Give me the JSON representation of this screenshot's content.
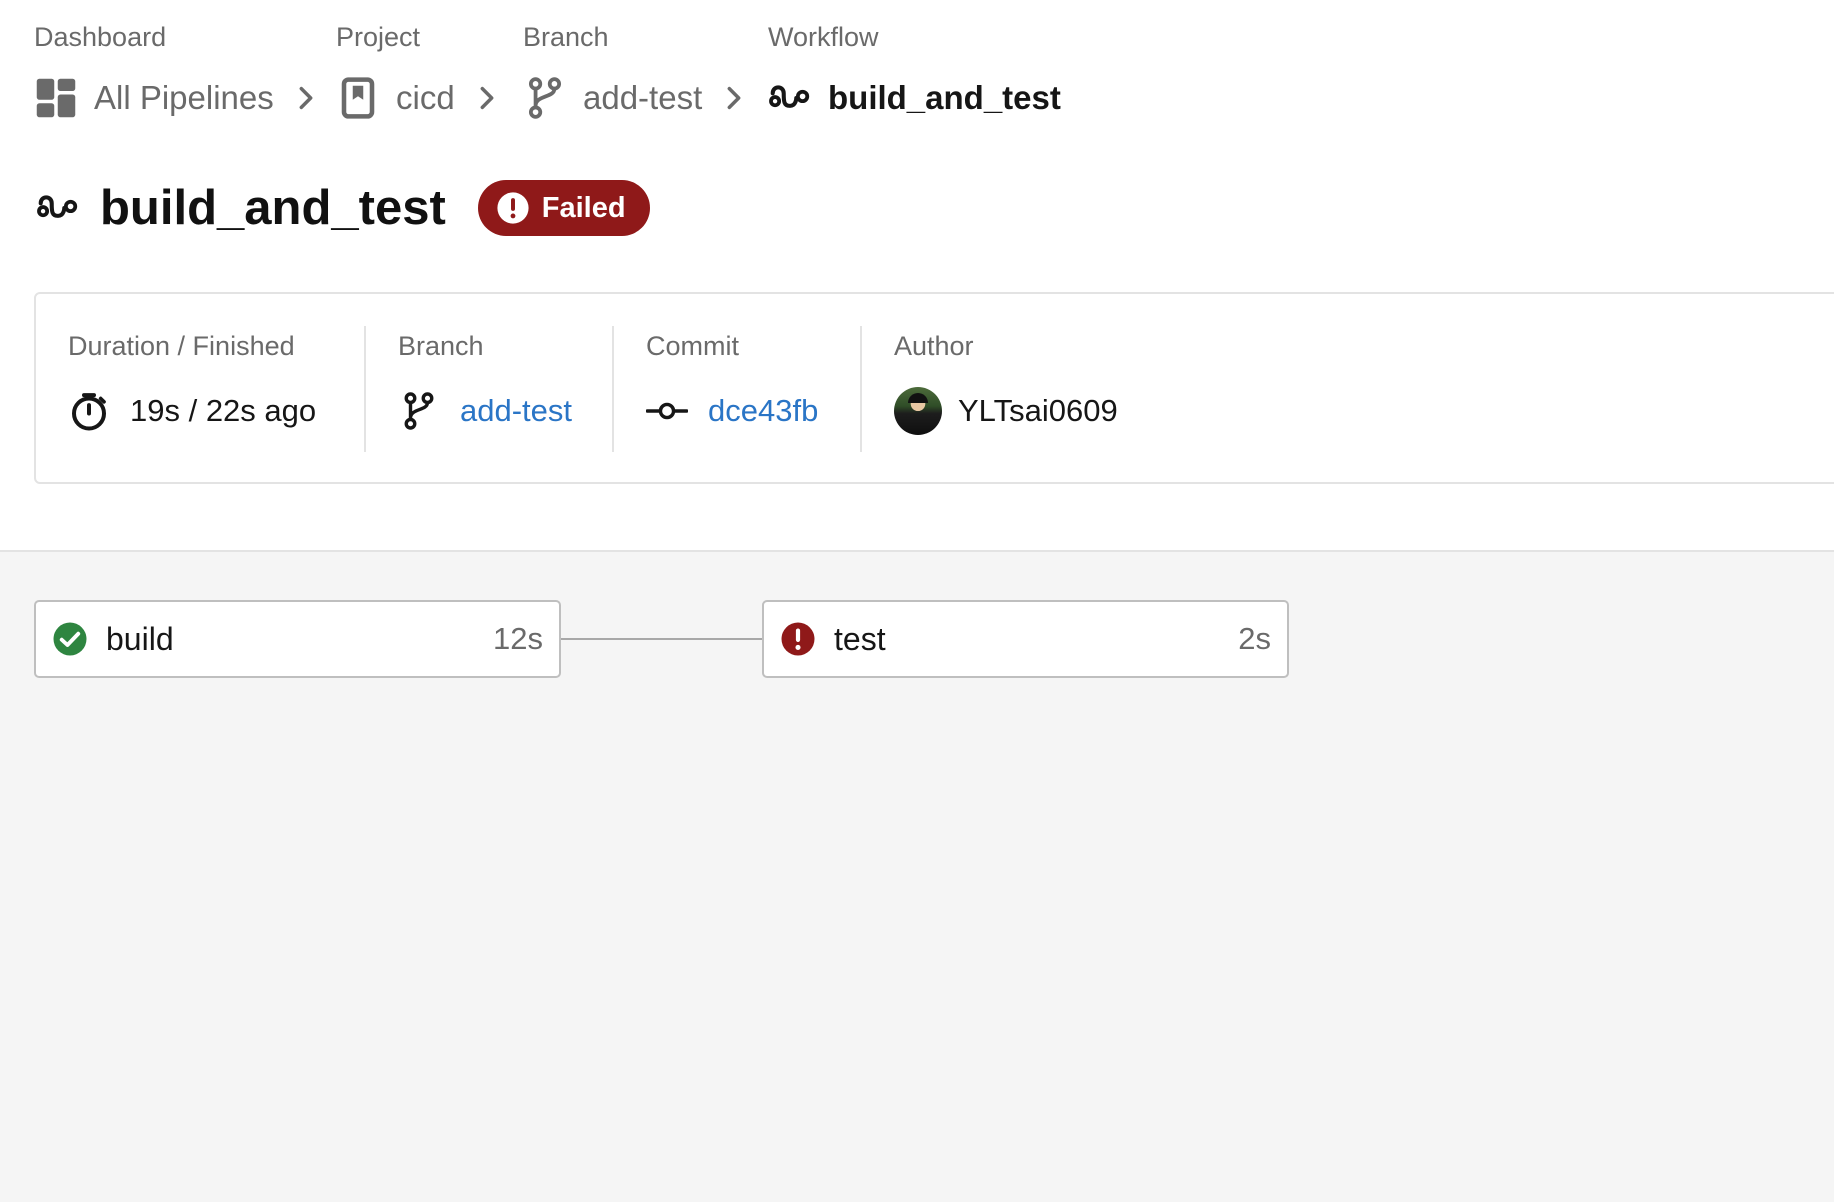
{
  "breadcrumb": {
    "items": [
      {
        "category": "Dashboard",
        "label": "All Pipelines",
        "icon": "dashboard-icon"
      },
      {
        "category": "Project",
        "label": "cicd",
        "icon": "project-bookmark-icon"
      },
      {
        "category": "Branch",
        "label": "add-test",
        "icon": "branch-icon"
      },
      {
        "category": "Workflow",
        "label": "build_and_test",
        "icon": "workflow-icon"
      }
    ]
  },
  "header": {
    "title": "build_and_test",
    "status": "Failed",
    "status_color": "#8f1919"
  },
  "info": {
    "duration": {
      "label": "Duration / Finished",
      "value": "19s / 22s ago"
    },
    "branch": {
      "label": "Branch",
      "value": "add-test"
    },
    "commit": {
      "label": "Commit",
      "value": "dce43fb"
    },
    "author": {
      "label": "Author",
      "value": "YLTsai0609"
    }
  },
  "jobs": [
    {
      "name": "build",
      "duration": "12s",
      "status": "success",
      "status_color": "#2e8540"
    },
    {
      "name": "test",
      "duration": "2s",
      "status": "failed",
      "status_color": "#8f1919"
    }
  ],
  "colors": {
    "link": "#2a75c6",
    "muted": "#6a6a6a",
    "canvas": "#f5f5f5"
  }
}
